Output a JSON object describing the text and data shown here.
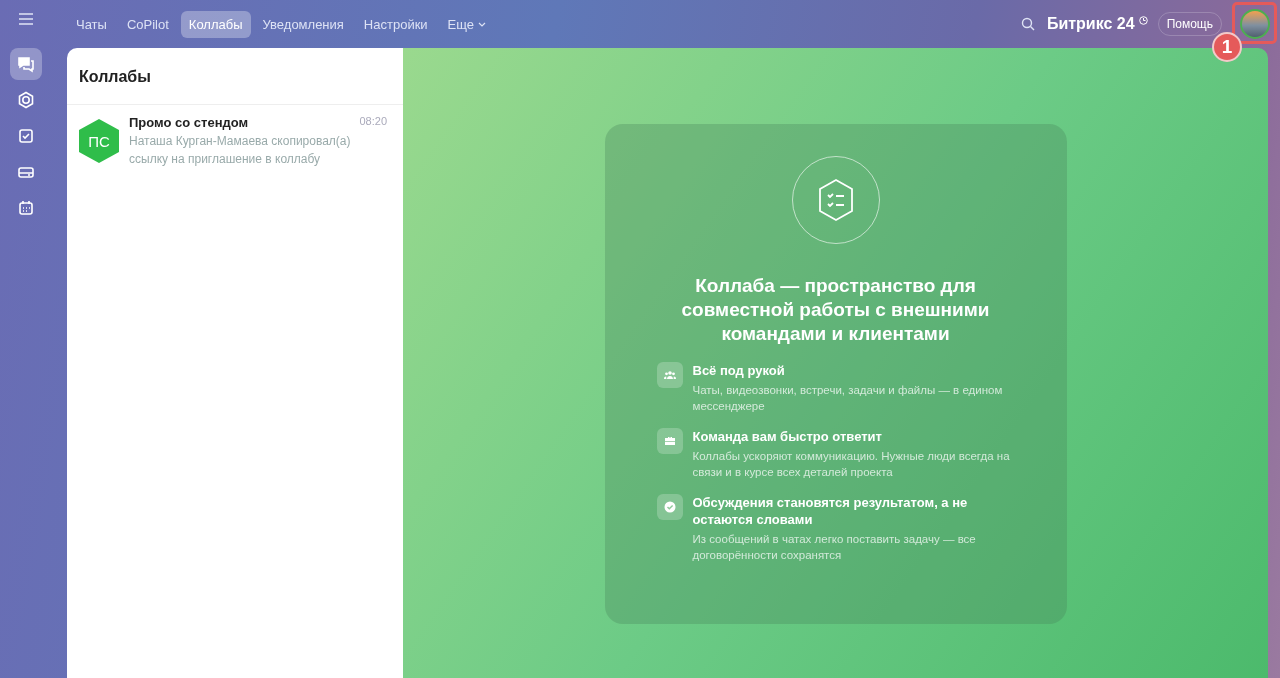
{
  "tabs": [
    {
      "label": "Чаты",
      "selected": false
    },
    {
      "label": "CoPilot",
      "selected": false
    },
    {
      "label": "Коллабы",
      "selected": true
    },
    {
      "label": "Уведомления",
      "selected": false
    },
    {
      "label": "Настройки",
      "selected": false
    },
    {
      "label": "Еще",
      "selected": false,
      "kind": "dropdown"
    }
  ],
  "header": {
    "brand": "Битрикс 24",
    "help": "Помощь",
    "callout": "1"
  },
  "sidebar": {
    "items": [
      {
        "kind": "chat",
        "selected": true
      },
      {
        "kind": "hexagon",
        "selected": false
      },
      {
        "kind": "task",
        "selected": false
      },
      {
        "kind": "drive",
        "selected": false
      },
      {
        "kind": "calendar",
        "selected": false
      }
    ]
  },
  "list": {
    "title": "Коллабы",
    "chats": [
      {
        "initials": "ПС",
        "name": "Промо со стендом",
        "time": "08:20",
        "preview": "Наташа Курган-Мамаева скопировал(а) ссылку на приглашение в коллабу"
      }
    ]
  },
  "promo": {
    "title": "Коллаба — пространство для совместной работы с внешними командами и клиентами",
    "features": [
      {
        "kind": "people",
        "title": "Всё под рукой",
        "text": "Чаты, видеозвонки, встречи, задачи и файлы — в едином мессенджере"
      },
      {
        "kind": "briefcase",
        "title": "Команда вам быстро ответит",
        "text": "Коллабы ускоряют коммуникацию. Нужные люди всегда на связи и в курсе всех деталей проекта"
      },
      {
        "kind": "check",
        "title": "Обсуждения становятся результатом, а не остаются словами",
        "text": "Из сообщений в чатах легко поставить задачу — все договорённости сохранятся"
      }
    ]
  }
}
